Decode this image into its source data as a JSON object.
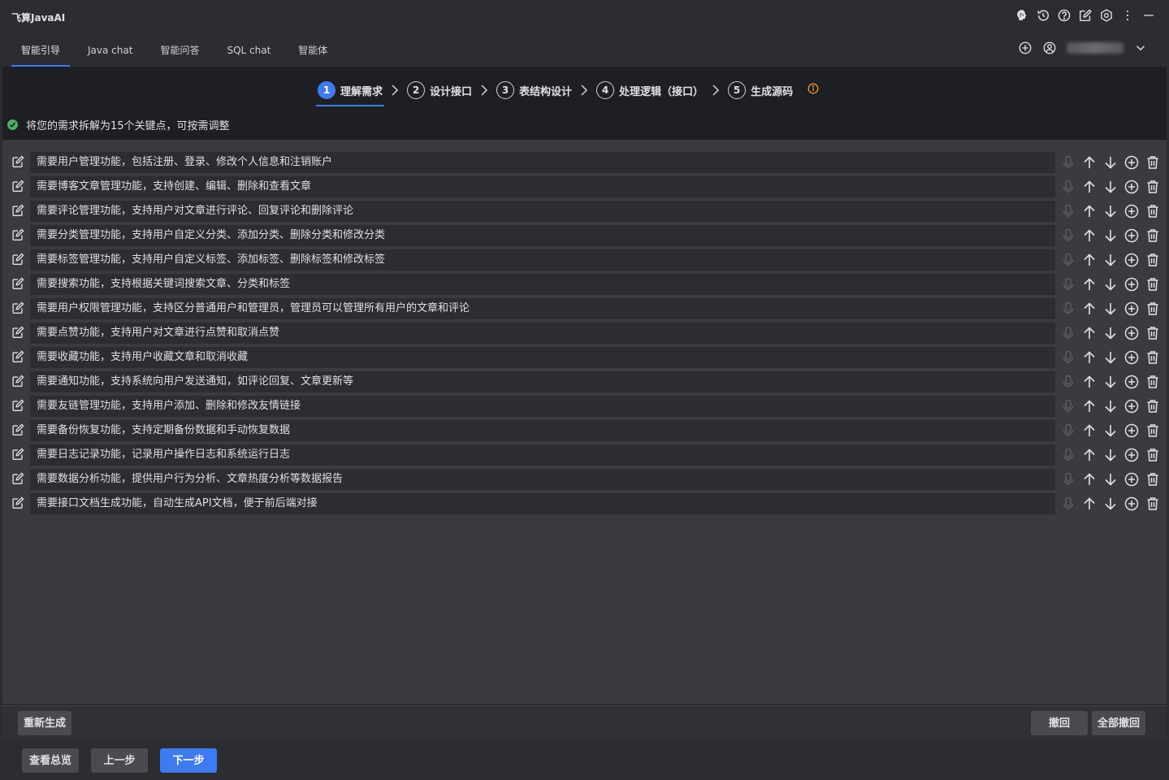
{
  "app": {
    "title": "飞算JavaAI"
  },
  "tabs": [
    {
      "label": "智能引导",
      "active": true
    },
    {
      "label": "Java chat",
      "active": false
    },
    {
      "label": "智能问答",
      "active": false
    },
    {
      "label": "SQL chat",
      "active": false
    },
    {
      "label": "智能体",
      "active": false
    }
  ],
  "steps": [
    {
      "num": "1",
      "label": "理解需求",
      "active": true
    },
    {
      "num": "2",
      "label": "设计接口",
      "active": false
    },
    {
      "num": "3",
      "label": "表结构设计",
      "active": false
    },
    {
      "num": "4",
      "label": "处理逻辑（接口）",
      "active": false
    },
    {
      "num": "5",
      "label": "生成源码",
      "active": false
    }
  ],
  "summary": {
    "text": "将您的需求拆解为15个关键点，可按需调整"
  },
  "requirements": [
    "需要用户管理功能，包括注册、登录、修改个人信息和注销账户",
    "需要博客文章管理功能，支持创建、编辑、删除和查看文章",
    "需要评论管理功能，支持用户对文章进行评论、回复评论和删除评论",
    "需要分类管理功能，支持用户自定义分类、添加分类、删除分类和修改分类",
    "需要标签管理功能，支持用户自定义标签、添加标签、删除标签和修改标签",
    "需要搜索功能，支持根据关键词搜索文章、分类和标签",
    "需要用户权限管理功能，支持区分普通用户和管理员，管理员可以管理所有用户的文章和评论",
    "需要点赞功能，支持用户对文章进行点赞和取消点赞",
    "需要收藏功能，支持用户收藏文章和取消收藏",
    "需要通知功能，支持系统向用户发送通知，如评论回复、文章更新等",
    "需要友链管理功能，支持用户添加、删除和修改友情链接",
    "需要备份恢复功能，支持定期备份数据和手动恢复数据",
    "需要日志记录功能，记录用户操作日志和系统运行日志",
    "需要数据分析功能，提供用户行为分析、文章热度分析等数据报告",
    "需要接口文档生成功能，自动生成API文档，便于前后端对接"
  ],
  "bottom": {
    "regenerate": "重新生成",
    "undo": "撤回",
    "undo_all": "全部撤回"
  },
  "footer": {
    "overview": "查看总览",
    "prev": "上一步",
    "next": "下一步"
  },
  "colors": {
    "accent": "#3d7bf0",
    "success": "#4caf6a",
    "warning": "#e0a030"
  }
}
